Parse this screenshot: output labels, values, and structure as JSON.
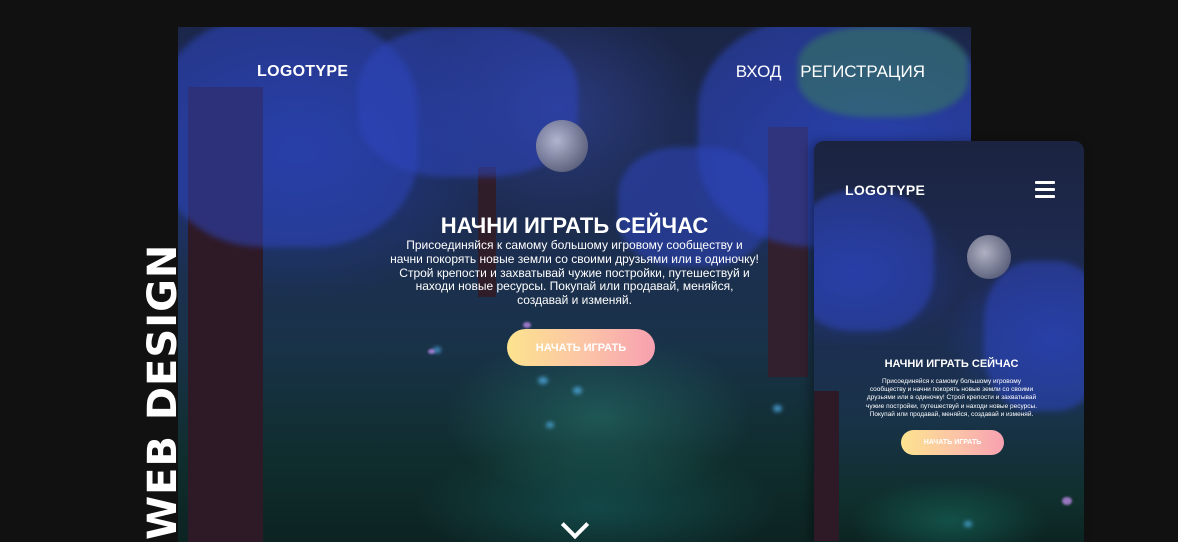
{
  "side_label": "WEB DESIGN",
  "desktop": {
    "logo": "LOGOTYPE",
    "nav": {
      "login": "ВХОД",
      "register": "РЕГИСТРАЦИЯ"
    },
    "hero": {
      "title": "НАЧНИ ИГРАТЬ СЕЙЧАС",
      "lines": [
        "Присоединяйся к самому большому игровому сообществу и",
        "начни покорять новые земли со своими друзьями или в одиночку!",
        "Строй крепости и захватывай чужие постройки, путешествуй и",
        "находи новые ресурсы. Покупай или продавай, меняйся,",
        "создавай и изменяй."
      ],
      "button": "НАЧАТЬ ИГРАТЬ"
    },
    "scroll_icon": "chevron-down-icon"
  },
  "mobile": {
    "logo": "LOGOTYPE",
    "menu_icon": "hamburger-menu-icon",
    "hero": {
      "title": "НАЧНИ ИГРАТЬ СЕЙЧАС",
      "lines": [
        "Присоединяйся к самому большому игровому",
        "сообществу и начни покорять новые земли со своими",
        "друзьями или в одиночку! Строй крепости и захватывай",
        "чужие постройки, путешествуй и находи новые ресурсы.",
        "Покупай или продавай, меняйся, создавай и изменяй."
      ],
      "button": "НАЧАТЬ ИГРАТЬ"
    }
  },
  "colors": {
    "background": "#111112",
    "button_gradient_start": "#fde38f",
    "button_gradient_end": "#f7a0b0",
    "text": "#ffffff"
  }
}
